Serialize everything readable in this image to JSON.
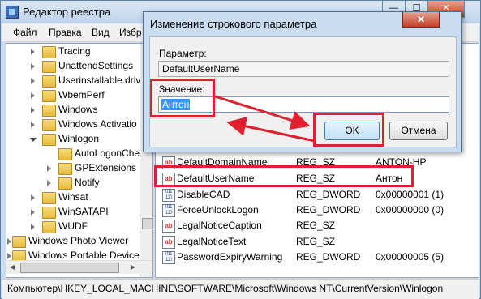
{
  "window": {
    "title": "Редактор реестра",
    "controls": {
      "minimize": "—",
      "maximize": "☐",
      "close": "✕"
    }
  },
  "menu": [
    "Файл",
    "Правка",
    "Вид",
    "Избр"
  ],
  "tree": [
    {
      "label": "Tracing",
      "level": 2,
      "expandable": true
    },
    {
      "label": "UnattendSettings",
      "level": 2,
      "expandable": true
    },
    {
      "label": "Userinstallable.driv",
      "level": 2,
      "expandable": true
    },
    {
      "label": "WbemPerf",
      "level": 2,
      "expandable": true
    },
    {
      "label": "Windows",
      "level": 2,
      "expandable": true
    },
    {
      "label": "Windows Activatio",
      "level": 2,
      "expandable": true
    },
    {
      "label": "Winlogon",
      "level": 2,
      "expandable": true,
      "expanded": true
    },
    {
      "label": "AutoLogonChe",
      "level": 3,
      "expandable": false
    },
    {
      "label": "GPExtensions",
      "level": 3,
      "expandable": true
    },
    {
      "label": "Notify",
      "level": 3,
      "expandable": true
    },
    {
      "label": "Winsat",
      "level": 2,
      "expandable": true
    },
    {
      "label": "WinSATAPI",
      "level": 2,
      "expandable": true
    },
    {
      "label": "WUDF",
      "level": 2,
      "expandable": true
    },
    {
      "label": "Windows Photo Viewer",
      "level": 1,
      "expandable": true
    },
    {
      "label": "Windows Portable Devices",
      "level": 1,
      "expandable": true
    }
  ],
  "values": [
    {
      "name": "DefaultDomainName",
      "type": "REG_SZ",
      "data": "ANTON-HP",
      "icon": "string"
    },
    {
      "name": "DefaultUserName",
      "type": "REG_SZ",
      "data": "Антон",
      "icon": "string"
    },
    {
      "name": "DisableCAD",
      "type": "REG_DWORD",
      "data": "0x00000001 (1)",
      "icon": "binary"
    },
    {
      "name": "ForceUnlockLogon",
      "type": "REG_DWORD",
      "data": "0x00000000 (0)",
      "icon": "binary"
    },
    {
      "name": "LegalNoticeCaption",
      "type": "REG_SZ",
      "data": "",
      "icon": "string"
    },
    {
      "name": "LegalNoticeText",
      "type": "REG_SZ",
      "data": "",
      "icon": "string"
    },
    {
      "name": "PasswordExpiryWarning",
      "type": "REG_DWORD",
      "data": "0x00000005 (5)",
      "icon": "binary"
    }
  ],
  "status": "Компьютер\\HKEY_LOCAL_MACHINE\\SOFTWARE\\Microsoft\\Windows NT\\CurrentVersion\\Winlogon",
  "dialog": {
    "title": "Изменение строкового параметра",
    "close": "✕",
    "param_label": "Параметр:",
    "param_value": "DefaultUserName",
    "value_label": "Значение:",
    "value_text": "Антон",
    "ok": "OK",
    "cancel": "Отмена"
  },
  "colors": {
    "highlight": "#e0202e",
    "selection": "#3399ff"
  }
}
